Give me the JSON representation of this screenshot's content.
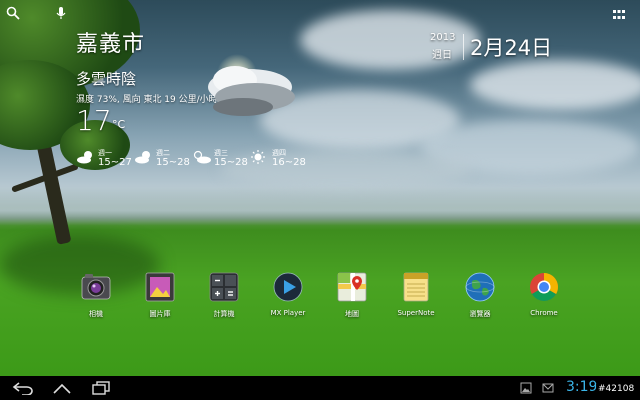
{
  "weather": {
    "city": "嘉義市",
    "condition": "多雲時陰",
    "details": "濕度 73%, 風向 東北 19 公里/小時",
    "temperature": "17",
    "unit": "°C",
    "forecast": [
      {
        "day": "週一",
        "range": "15~27",
        "icon": "partly-cloudy-icon"
      },
      {
        "day": "週二",
        "range": "15~28",
        "icon": "partly-cloudy-icon"
      },
      {
        "day": "週三",
        "range": "15~28",
        "icon": "sun-cloud-icon"
      },
      {
        "day": "週四",
        "range": "16~28",
        "icon": "sunny-icon"
      }
    ]
  },
  "date": {
    "year": "2013",
    "weekday": "週日",
    "month_day": "2月24日"
  },
  "dock": [
    {
      "label": "相機",
      "icon": "camera-icon"
    },
    {
      "label": "圖片庫",
      "icon": "gallery-icon"
    },
    {
      "label": "計算機",
      "icon": "calculator-icon"
    },
    {
      "label": "MX Player",
      "icon": "play-icon"
    },
    {
      "label": "地圖",
      "icon": "maps-icon"
    },
    {
      "label": "SuperNote",
      "icon": "notepad-icon"
    },
    {
      "label": "瀏覽器",
      "icon": "globe-icon"
    },
    {
      "label": "Chrome",
      "icon": "chrome-icon"
    }
  ],
  "statusbar": {
    "clock": "3:19",
    "watermark": "#42108"
  },
  "colors": {
    "clock": "#3bb5e8",
    "navbar": "#000000",
    "grass": "#4aa322"
  }
}
